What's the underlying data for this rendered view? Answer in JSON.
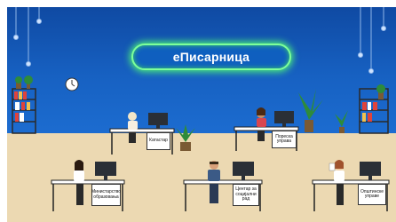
{
  "title": "еПисарница",
  "desks": [
    {
      "sign": "Катастар"
    },
    {
      "sign": "Пореска управа"
    },
    {
      "sign": "Министарство образовања"
    },
    {
      "sign": "Центар за социјални рад"
    },
    {
      "sign": "Општинске управе"
    }
  ],
  "colors": {
    "wall": "#1761c2",
    "floor": "#ecd9b2",
    "glow": "#4df07a"
  }
}
